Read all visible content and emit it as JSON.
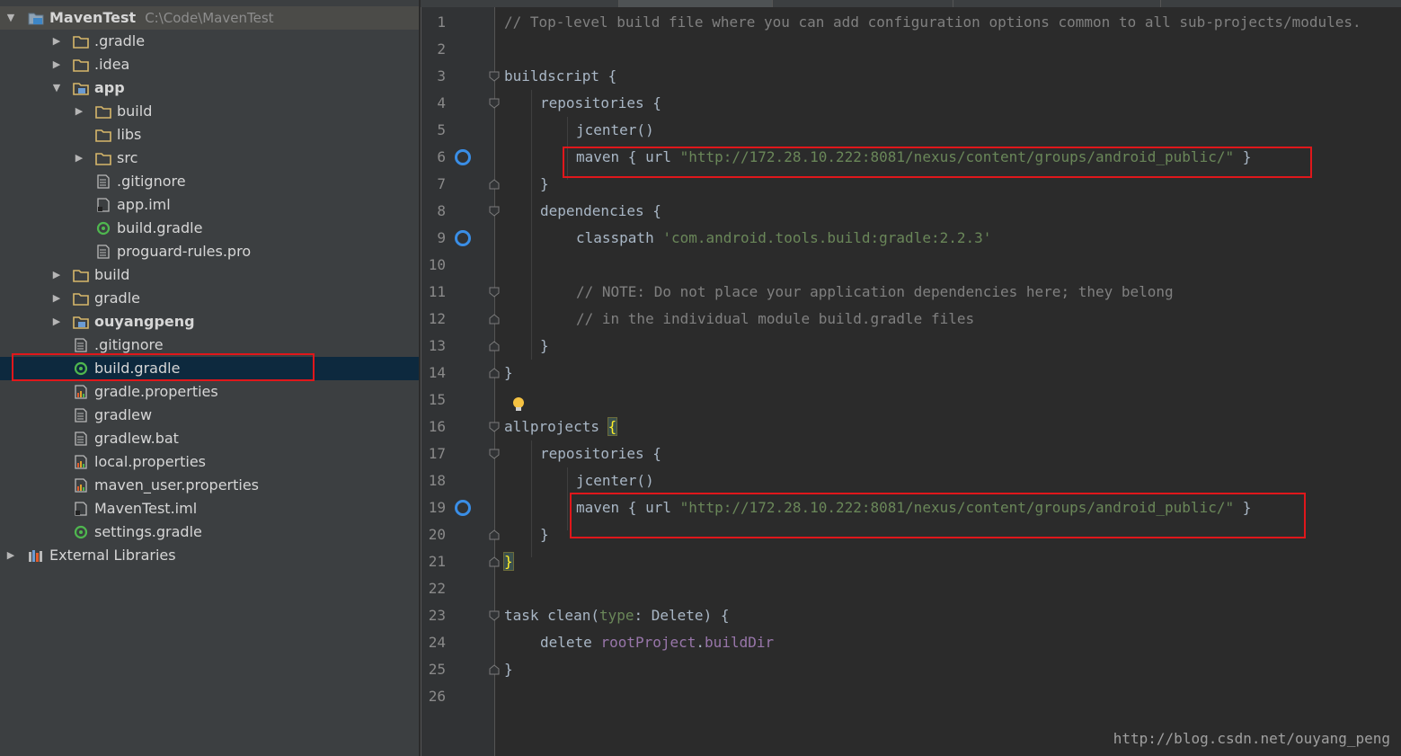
{
  "project": {
    "name": "MavenTest",
    "path": "C:\\Code\\MavenTest"
  },
  "tree": [
    {
      "label": ".gradle",
      "icon": "folder-icon",
      "arrow": "▶"
    },
    {
      "label": ".idea",
      "icon": "folder-icon",
      "arrow": "▶"
    },
    {
      "label": "app",
      "icon": "module-folder-icon",
      "arrow": "▼"
    },
    {
      "label": "build",
      "icon": "folder-icon",
      "arrow": "▶"
    },
    {
      "label": "libs",
      "icon": "folder-icon",
      "arrow": ""
    },
    {
      "label": "src",
      "icon": "folder-icon",
      "arrow": "▶"
    },
    {
      "label": ".gitignore",
      "icon": "text-file-icon",
      "arrow": ""
    },
    {
      "label": "app.iml",
      "icon": "iml-file-icon",
      "arrow": ""
    },
    {
      "label": "build.gradle",
      "icon": "gradle-file-icon",
      "arrow": ""
    },
    {
      "label": "proguard-rules.pro",
      "icon": "text-file-icon",
      "arrow": ""
    },
    {
      "label": "build",
      "icon": "folder-icon",
      "arrow": "▶"
    },
    {
      "label": "gradle",
      "icon": "folder-icon",
      "arrow": "▶"
    },
    {
      "label": "ouyangpeng",
      "icon": "module-folder-icon",
      "arrow": "▶"
    },
    {
      "label": ".gitignore",
      "icon": "text-file-icon",
      "arrow": ""
    },
    {
      "label": "build.gradle",
      "icon": "gradle-file-icon",
      "arrow": ""
    },
    {
      "label": "gradle.properties",
      "icon": "properties-file-icon",
      "arrow": ""
    },
    {
      "label": "gradlew",
      "icon": "text-file-icon",
      "arrow": ""
    },
    {
      "label": "gradlew.bat",
      "icon": "text-file-icon",
      "arrow": ""
    },
    {
      "label": "local.properties",
      "icon": "properties-file-icon",
      "arrow": ""
    },
    {
      "label": "maven_user.properties",
      "icon": "properties-file-icon",
      "arrow": ""
    },
    {
      "label": "MavenTest.iml",
      "icon": "iml-file-icon",
      "arrow": ""
    },
    {
      "label": "settings.gradle",
      "icon": "gradle-file-icon",
      "arrow": ""
    },
    {
      "label": "External Libraries",
      "icon": "libraries-icon",
      "arrow": "▶"
    }
  ],
  "code": {
    "line_numbers": [
      "1",
      "2",
      "3",
      "4",
      "5",
      "6",
      "7",
      "8",
      "9",
      "10",
      "11",
      "12",
      "13",
      "14",
      "15",
      "16",
      "17",
      "18",
      "19",
      "20",
      "21",
      "22",
      "23",
      "24",
      "25",
      "26"
    ],
    "l1": "// Top-level build file where you can add configuration options common to all sub-projects/modules.",
    "l3": "buildscript {",
    "l4": "repositories {",
    "l5": "jcenter()",
    "l6_kw": "maven { url ",
    "l6_str": "\"http://172.28.10.222:8081/nexus/content/groups/android_public/\"",
    "l6_end": " }",
    "l7": "}",
    "l8": "dependencies {",
    "l9_kw": "classpath ",
    "l9_str": "'com.android.tools.build:gradle:2.2.3'",
    "l11": "// NOTE: Do not place your application dependencies here; they belong",
    "l12": "// in the individual module build.gradle files",
    "l13": "}",
    "l14": "}",
    "l16_kw": "allprojects ",
    "l16_brace": "{",
    "l17": "repositories {",
    "l18": "jcenter()",
    "l19_kw": "maven { url ",
    "l19_str": "\"http://172.28.10.222:8081/nexus/content/groups/android_public/\"",
    "l19_end": " }",
    "l20": "}",
    "l21": "}",
    "l23_a": "task clean(",
    "l23_type": "type",
    "l23_b": ": Delete) {",
    "l24_a": "delete ",
    "l24_b": "rootProject",
    "l24_c": ".",
    "l24_d": "buildDir",
    "l25": "}"
  },
  "watermark": "http://blog.csdn.net/ouyang_peng",
  "colors": {
    "highlight_box": "#e0171b",
    "breakpoint": "#3a8ee6",
    "selection": "#0d293e"
  }
}
